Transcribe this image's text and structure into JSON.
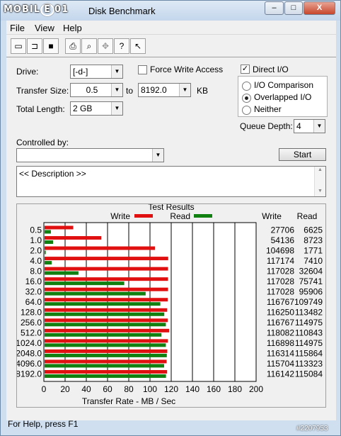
{
  "window": {
    "title": "Disk Benchmark",
    "watermark": "MOBILE01"
  },
  "titlebar_buttons": {
    "minimize": "–",
    "maximize": "□",
    "close": "X"
  },
  "menu": [
    "File",
    "View",
    "Help"
  ],
  "form": {
    "drive_label": "Drive:",
    "drive_value": "[-d-]",
    "force_write_label": "Force Write Access",
    "direct_io_label": "Direct I/O",
    "transfer_size_label": "Transfer Size:",
    "transfer_from": "0.5",
    "to_label": "to",
    "transfer_to": "8192.0",
    "unit": "KB",
    "total_length_label": "Total Length:",
    "total_length_value": "2 GB",
    "io_comparison": "I/O Comparison",
    "overlapped_io": "Overlapped I/O",
    "neither": "Neither",
    "queue_depth_label": "Queue Depth:",
    "queue_depth_value": "4",
    "controlled_by_label": "Controlled by:",
    "controlled_by_value": "",
    "start_button": "Start",
    "description": "<< Description >>"
  },
  "state": {
    "force_write": false,
    "direct_io": true,
    "mode": "overlapped"
  },
  "status": {
    "text": "For Help, press F1",
    "watermark_id": "#2207953"
  },
  "chart_data": {
    "type": "bar",
    "title": "Test Results",
    "xlabel": "Transfer Rate - MB / Sec",
    "xlim": [
      0,
      200
    ],
    "xticks": [
      0,
      20,
      40,
      60,
      80,
      100,
      120,
      140,
      160,
      180,
      200
    ],
    "categories": [
      "0.5",
      "1.0",
      "2.0",
      "4.0",
      "8.0",
      "16.0",
      "32.0",
      "64.0",
      "128.0",
      "256.0",
      "512.0",
      "1024.0",
      "2048.0",
      "4096.0",
      "8192.0"
    ],
    "table_headers": [
      "Write",
      "Read"
    ],
    "series": [
      {
        "name": "Write",
        "color": "#e01010",
        "values": [
          27706,
          54136,
          104698,
          117174,
          117028,
          117028,
          117028,
          116767,
          116250,
          116767,
          118082,
          116898,
          116314,
          115704,
          116142
        ]
      },
      {
        "name": "Read",
        "color": "#108010",
        "values": [
          6625,
          8723,
          1771,
          7410,
          32604,
          75741,
          95906,
          109749,
          113482,
          114975,
          110843,
          114975,
          115864,
          113323,
          115084
        ]
      }
    ]
  }
}
